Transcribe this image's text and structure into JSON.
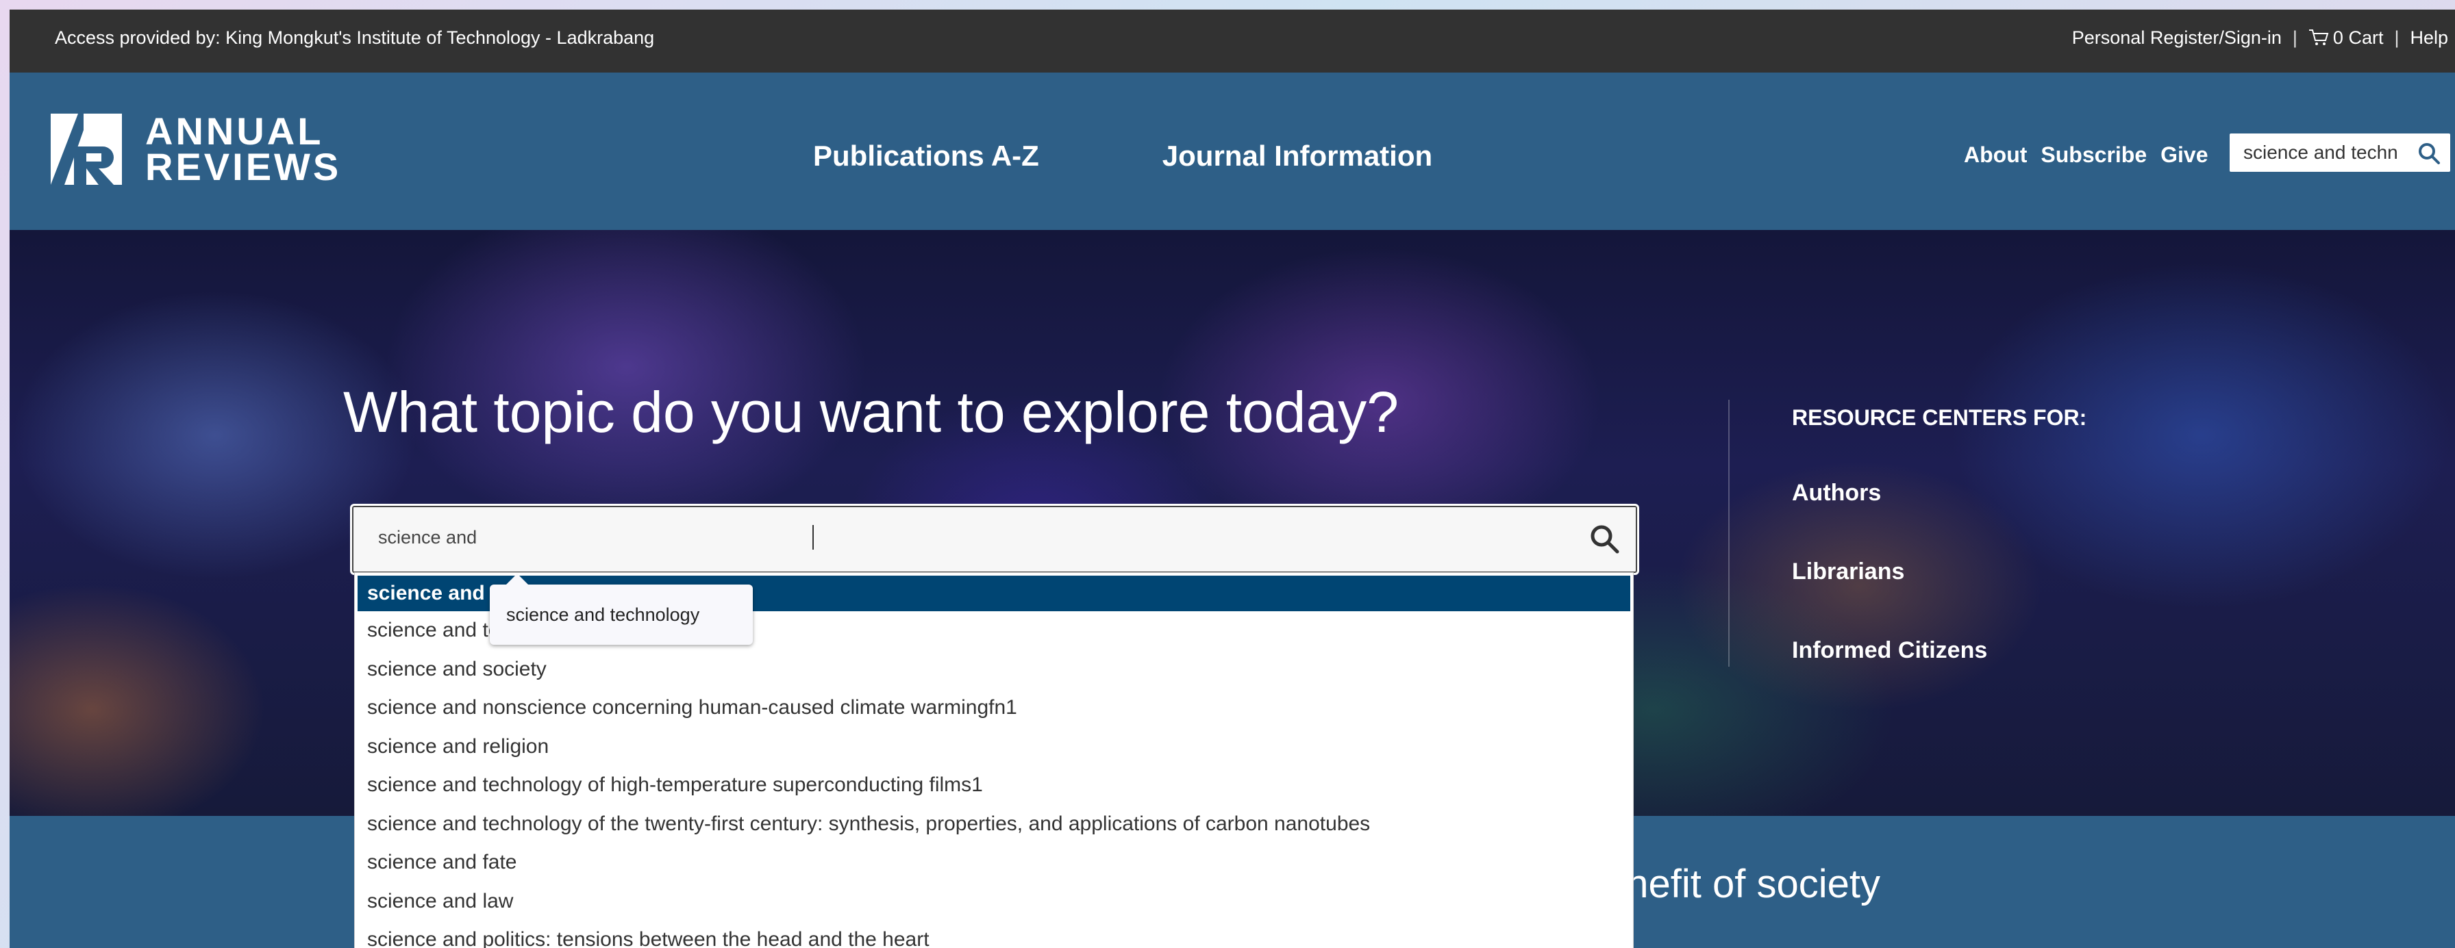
{
  "topbar": {
    "access_text": "Access provided by: King Mongkut's Institute of Technology - Ladkrabang",
    "personal": "Personal Register/Sign-in",
    "cart": "0 Cart",
    "help": "Help"
  },
  "header": {
    "logo_line1": "ANNUAL",
    "logo_line2": "REVIEWS",
    "nav": [
      "Publications A-Z",
      "Journal Information"
    ],
    "secondary": [
      "About",
      "Subscribe",
      "Give"
    ],
    "search_value": "science and techn"
  },
  "hero": {
    "title": "What topic do you want to explore today?",
    "search_value": "science and",
    "resources_heading": "RESOURCE CENTERS FOR:",
    "resources": [
      "Authors",
      "Librarians",
      "Informed Citizens"
    ],
    "tagline": "enefit of society"
  },
  "autocomplete": {
    "items": [
      "science and t",
      "science and te",
      "science and society",
      "science and nonscience concerning human-caused climate warmingfn1",
      "science and religion",
      "science and technology of high-temperature superconducting films1",
      "science and technology of the twenty-first century: synthesis, properties, and applications of carbon nanotubes",
      "science and fate",
      "science and law",
      "science and politics: tensions between the head and the heart"
    ],
    "tooltip": "science and technology"
  },
  "colors": {
    "header_bg": "#2e5f87",
    "topbar_bg": "#323232",
    "active_item_bg": "#004573"
  }
}
